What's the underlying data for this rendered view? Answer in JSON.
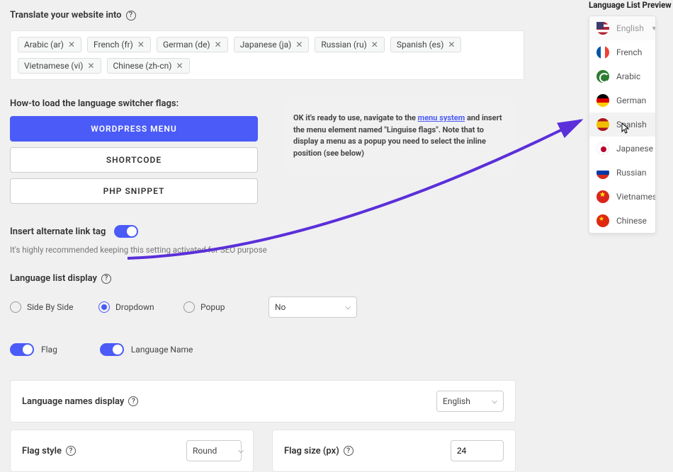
{
  "translate": {
    "label": "Translate your website into",
    "chips": [
      "Arabic (ar)",
      "French (fr)",
      "German (de)",
      "Japanese (ja)",
      "Russian (ru)",
      "Spanish (es)",
      "Vietnamese (vi)",
      "Chinese (zh-cn)"
    ]
  },
  "howto_label": "How-to load the language switcher flags:",
  "buttons": {
    "wordpress": "WORDPRESS MENU",
    "shortcode": "SHORTCODE",
    "php": "PHP SNIPPET"
  },
  "info": {
    "prefix": "OK it's ready to use, navigate to the ",
    "link": "menu system",
    "suffix": " and insert the menu element named \"Linguise flags\". Note that to display a menu as a popup you need to select the inline position (see below)"
  },
  "alt_tag": {
    "label": "Insert alternate link tag",
    "hint": "It's highly recommended keeping this setting activated for SEO purpose"
  },
  "list_display": {
    "label": "Language list display",
    "options": {
      "side": "Side By Side",
      "dropdown": "Dropdown",
      "popup": "Popup"
    },
    "selected": "dropdown",
    "no_select": "No"
  },
  "toggles": {
    "flag": "Flag",
    "lang_name": "Language Name"
  },
  "names_display": {
    "label": "Language names display",
    "value": "English"
  },
  "flag_style": {
    "label": "Flag style",
    "value": "Round"
  },
  "flag_size": {
    "label": "Flag size (px)",
    "value": "24"
  },
  "preview": {
    "title": "Language List Preview",
    "header": "English",
    "items": [
      {
        "label": "French",
        "flag": "fr-f"
      },
      {
        "label": "Arabic",
        "flag": "ar-f"
      },
      {
        "label": "German",
        "flag": "de-f"
      },
      {
        "label": "Spanish",
        "flag": "es-f",
        "hover": true
      },
      {
        "label": "Japanese",
        "flag": "jp-f"
      },
      {
        "label": "Russian",
        "flag": "ru-f"
      },
      {
        "label": "Vietnamese",
        "flag": "vi-f"
      },
      {
        "label": "Chinese",
        "flag": "cn-f"
      }
    ]
  }
}
